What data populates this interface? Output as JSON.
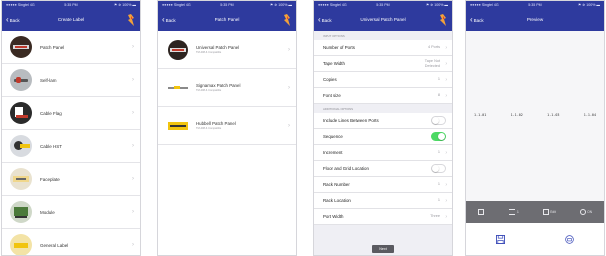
{
  "status": {
    "carrier": "●●●●● Singtel 4G",
    "time": "5:35 PM",
    "battery": "⚑ ✲ 100% ▬"
  },
  "brand_color": "#2e3a9e",
  "screens": [
    {
      "back_label": "Back",
      "title": "Create Label",
      "items": [
        {
          "label": "Patch Panel",
          "icon": "patch-panel-thumb"
        },
        {
          "label": "Self-lam",
          "icon": "self-lam-thumb"
        },
        {
          "label": "Cable Flag",
          "icon": "cable-flag-thumb"
        },
        {
          "label": "Cable HST",
          "icon": "cable-hst-thumb"
        },
        {
          "label": "Faceplate",
          "icon": "faceplate-thumb"
        },
        {
          "label": "Module",
          "icon": "module-thumb"
        },
        {
          "label": "General Label",
          "icon": "general-label-thumb"
        }
      ]
    },
    {
      "back_label": "Back",
      "title": "Patch Panel",
      "items": [
        {
          "title": "Universal Patch Panel",
          "subtitle": "TM-408 & Compatible"
        },
        {
          "title": "Signamax Patch Panel",
          "subtitle": "TM-408 & Compatible"
        },
        {
          "title": "Hubbell Patch Panel",
          "subtitle": "TM-408 & Compatible"
        }
      ]
    },
    {
      "back_label": "Back",
      "title": "Universal Patch Panel",
      "section1": "INPUT OPTIONS",
      "rows1": [
        {
          "label": "Number of Ports",
          "value": "4 Ports"
        },
        {
          "label": "Tape Width",
          "value": "Tape Not Detected"
        },
        {
          "label": "Copies",
          "value": "1"
        },
        {
          "label": "Font size",
          "value": "8"
        }
      ],
      "section2": "ADDITIONAL OPTIONS",
      "toggle1": {
        "label": "Include Lines Between Ports",
        "on": false
      },
      "toggle2": {
        "label": "Sequence",
        "on": true
      },
      "increment": {
        "label": "Increment",
        "value": "1"
      },
      "toggle3": {
        "label": "Floor and Grid Location",
        "on": false
      },
      "rows2": [
        {
          "label": "Rack Number",
          "value": "1"
        },
        {
          "label": "Rack Location",
          "value": "1"
        },
        {
          "label": "Port Width",
          "value": "Three"
        }
      ],
      "next_label": "Next"
    },
    {
      "back_label": "Back",
      "title": "Preview",
      "labels": [
        "1-1-01",
        "1-1-02",
        "1-1-03",
        "1-1-04"
      ],
      "toolbar": [
        {
          "label": "",
          "icon": "copy-icon"
        },
        {
          "label": "1",
          "icon": "lines-icon"
        },
        {
          "label": "Edit",
          "icon": "image-edit-icon"
        },
        {
          "label": "ON",
          "icon": "settings-icon"
        }
      ]
    }
  ]
}
